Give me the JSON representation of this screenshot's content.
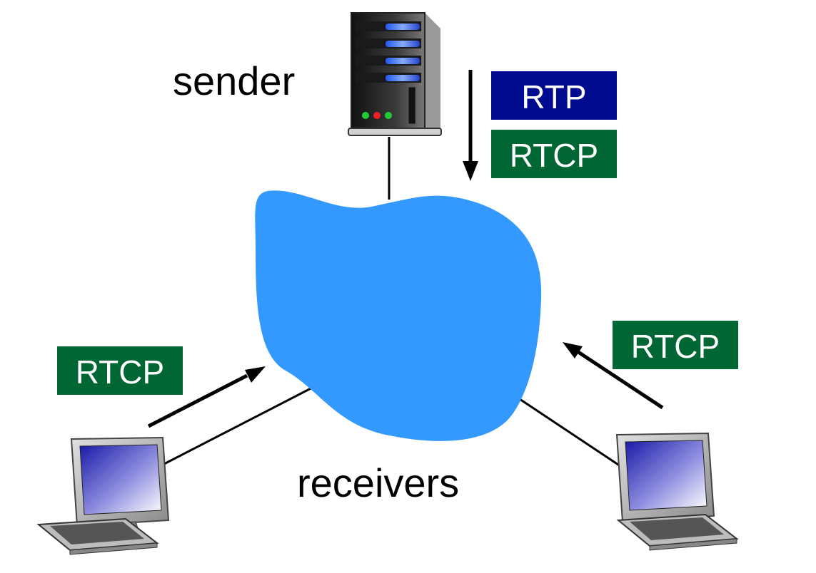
{
  "labels": {
    "sender": "sender",
    "receivers": "receivers"
  },
  "badges": {
    "rtp": "RTP",
    "rtcp_sender": "RTCP",
    "rtcp_left": "RTCP",
    "rtcp_right": "RTCP"
  },
  "colors": {
    "rtp_badge": "#000b8f",
    "rtcp_badge": "#006633",
    "network_cloud": "#3399ff",
    "link_line": "#000000",
    "arrow": "#000000"
  },
  "icons": {
    "sender": "server-icon",
    "receiver_left": "desktop-computer-icon",
    "receiver_right": "desktop-computer-icon",
    "network": "network-cloud-icon"
  }
}
